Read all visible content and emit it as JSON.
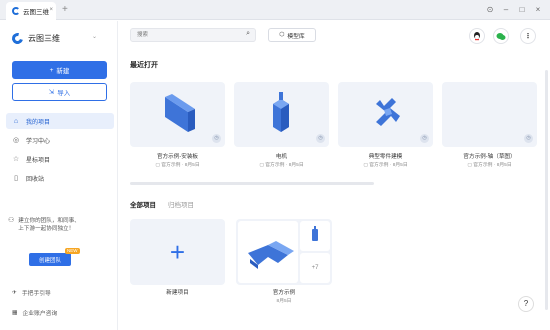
{
  "titlebar": {
    "tab_title": "云图三维",
    "tab_close": "×",
    "tab_add": "+",
    "controls": [
      "⊙",
      "–",
      "□",
      "×"
    ]
  },
  "sidebar": {
    "brand": "云图三维",
    "new_label": "新建",
    "import_label": "导入",
    "nav": [
      {
        "label": "我的项目",
        "icon": "home-icon",
        "glyph": "⌂",
        "active": true
      },
      {
        "label": "学习中心",
        "icon": "compass-icon",
        "glyph": "◎",
        "active": false
      },
      {
        "label": "星标项目",
        "icon": "star-icon",
        "glyph": "☆",
        "active": false
      },
      {
        "label": "回收站",
        "icon": "trash-icon",
        "glyph": "▯",
        "active": false
      }
    ],
    "invite_line1": "建立你的团队，和同事、",
    "invite_line2": "上下游一起协同独立！",
    "create_team": "创建团队",
    "team_badge": "NEW",
    "footer": [
      {
        "label": "手把手引导",
        "glyph": "✈"
      },
      {
        "label": "企业账户咨询",
        "glyph": "▦"
      }
    ]
  },
  "top": {
    "search_placeholder": "搜索",
    "model_lib": "模型库"
  },
  "recent": {
    "title": "最近打开",
    "cards": [
      {
        "title": "官方示例-安装板",
        "meta": "▢ 官方示例 · 8月5日"
      },
      {
        "title": "电机",
        "meta": "▢ 官方示例 · 8月5日"
      },
      {
        "title": "典型零件建模",
        "meta": "▢ 官方示例 · 8月5日"
      },
      {
        "title": "官方示例-轴（草图）",
        "meta": "▢ 官方示例 · 8月5日"
      }
    ]
  },
  "projects": {
    "tab_all": "全部项目",
    "tab_archive": "归档项目",
    "new_project": "新建项目",
    "folder_title": "官方示例",
    "folder_meta": "8月5日",
    "folder_more": "+7"
  },
  "colors": {
    "accent": "#2f6fe6",
    "card_bg": "#f0f3f9",
    "model_blue": "#4a7fe0"
  }
}
